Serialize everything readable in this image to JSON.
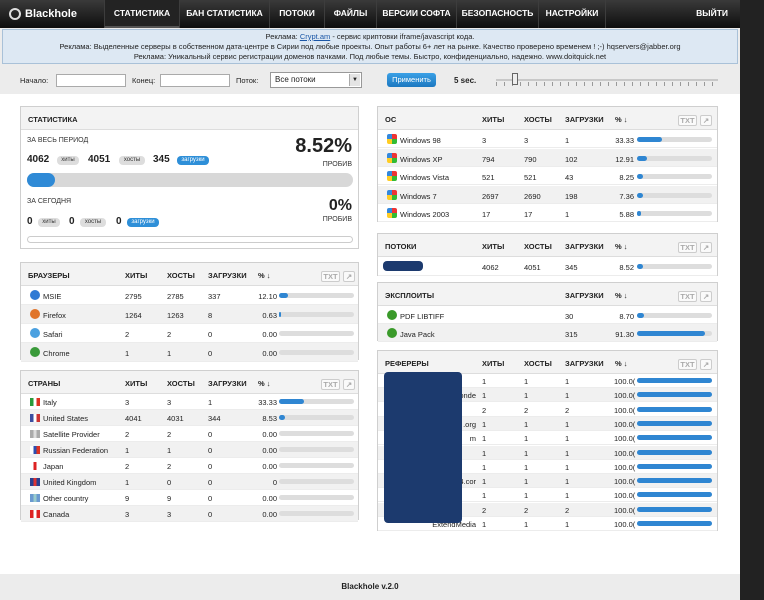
{
  "app": {
    "name": "Blackhole",
    "version": "Blackhole v.2.0"
  },
  "nav": {
    "items": [
      "СТАТИСТИКА",
      "БАН СТАТИСТИКА",
      "ПОТОКИ",
      "ФАЙЛЫ",
      "ВЕРСИИ СОФТА",
      "БЕЗОПАСНОСТЬ",
      "НАСТРОЙКИ"
    ],
    "exit": "ВЫЙТИ"
  },
  "ads": {
    "line1_pre": "Реклама: ",
    "line1_link": "Crypt.am",
    "line1_post": " - сервис криптовки iframe/javascript кода.",
    "line2": "Реклама: Выделенные серверы в собственном дата-центре в Сирии под любые проекты. Опыт работы 6+ лет на рынке. Качество проверено временем ! ;-) hqservers@jabber.org",
    "line3": "Реклама: Уникальный сервис регистрации доменов пачками. Под любые темы. Быстро, конфиденциально, надежно. www.doitquick.net"
  },
  "filter": {
    "start": "Начало:",
    "end": "Конец:",
    "thread": "Поток:",
    "thread_value": "Все потоки",
    "apply": "Применить",
    "interval": "5 sec."
  },
  "stats": {
    "title": "СТАТИСТИКА",
    "period_all": "ЗА ВЕСЬ ПЕРИОД",
    "hits": "4062",
    "hosts": "4051",
    "loads": "345",
    "pct": "8.52%",
    "pct_fill": 0.0852,
    "pct_label": "ПРОБИВ",
    "hits_label": "хиты",
    "hosts_label": "хосты",
    "loads_label": "загрузки",
    "today": "ЗА СЕГОДНЯ",
    "t_hits": "0",
    "t_hosts": "0",
    "t_loads": "0",
    "t_pct": "0%"
  },
  "cols": {
    "hits": "ХИТЫ",
    "hosts": "ХОСТЫ",
    "loads": "ЗАГРУЗКИ",
    "pct": "% ↓",
    "txt": "TXT",
    "ext": "↗"
  },
  "browsers": {
    "title": "БРАУЗЕРЫ",
    "rows": [
      {
        "name": "MSIE",
        "hits": "2795",
        "hosts": "2785",
        "loads": "337",
        "pct": "12.10",
        "fill": 0.121,
        "icon": "ie-icon",
        "color": "#2f7ad4"
      },
      {
        "name": "Firefox",
        "hits": "1264",
        "hosts": "1263",
        "loads": "8",
        "pct": "0.63",
        "fill": 0.0063,
        "icon": "firefox-icon",
        "color": "#e0742a"
      },
      {
        "name": "Safari",
        "hits": "2",
        "hosts": "2",
        "loads": "0",
        "pct": "0.00",
        "fill": 0,
        "icon": "safari-icon",
        "color": "#4aa0e0"
      },
      {
        "name": "Chrome",
        "hits": "1",
        "hosts": "1",
        "loads": "0",
        "pct": "0.00",
        "fill": 0,
        "icon": "chrome-icon",
        "color": "#3a9a3a"
      }
    ]
  },
  "countries": {
    "title": "СТРАНЫ",
    "rows": [
      {
        "name": "Italy",
        "hits": "3",
        "hosts": "3",
        "loads": "1",
        "pct": "33.33",
        "fill": 0.3333,
        "flag": [
          "#2a9a3a",
          "#fff",
          "#d32"
        ]
      },
      {
        "name": "United States",
        "hits": "4041",
        "hosts": "4031",
        "loads": "344",
        "pct": "8.53",
        "fill": 0.0853,
        "flag": [
          "#3b4ea0",
          "#fff",
          "#c33"
        ]
      },
      {
        "name": "Satellite Provider",
        "hits": "2",
        "hosts": "2",
        "loads": "0",
        "pct": "0.00",
        "fill": 0,
        "flag": [
          "#aaa",
          "#ddd",
          "#aaa"
        ]
      },
      {
        "name": "Russian Federation",
        "hits": "1",
        "hosts": "1",
        "loads": "0",
        "pct": "0.00",
        "fill": 0,
        "flag": [
          "#fff",
          "#2c4fb0",
          "#d32"
        ]
      },
      {
        "name": "Japan",
        "hits": "2",
        "hosts": "2",
        "loads": "0",
        "pct": "0.00",
        "fill": 0,
        "flag": [
          "#fff",
          "#d22",
          "#fff"
        ]
      },
      {
        "name": "United Kingdom",
        "hits": "1",
        "hosts": "0",
        "loads": "0",
        "pct": "0",
        "fill": 0,
        "flag": [
          "#2a3f8f",
          "#d33",
          "#2a3f8f"
        ]
      },
      {
        "name": "Other country",
        "hits": "9",
        "hosts": "9",
        "loads": "0",
        "pct": "0.00",
        "fill": 0,
        "flag": [
          "#6a9ad0",
          "#9cc",
          "#6a9ad0"
        ]
      },
      {
        "name": "Canada",
        "hits": "3",
        "hosts": "3",
        "loads": "0",
        "pct": "0.00",
        "fill": 0,
        "flag": [
          "#d22",
          "#fff",
          "#d22"
        ]
      }
    ]
  },
  "os": {
    "title": "ОС",
    "rows": [
      {
        "name": "Windows 98",
        "hits": "3",
        "hosts": "3",
        "loads": "1",
        "pct": "33.33",
        "fill": 0.3333
      },
      {
        "name": "Windows XP",
        "hits": "794",
        "hosts": "790",
        "loads": "102",
        "pct": "12.91",
        "fill": 0.1291
      },
      {
        "name": "Windows Vista",
        "hits": "521",
        "hosts": "521",
        "loads": "43",
        "pct": "8.25",
        "fill": 0.0825
      },
      {
        "name": "Windows 7",
        "hits": "2697",
        "hosts": "2690",
        "loads": "198",
        "pct": "7.36",
        "fill": 0.0736
      },
      {
        "name": "Windows 2003",
        "hits": "17",
        "hosts": "17",
        "loads": "1",
        "pct": "5.88",
        "fill": 0.0588
      }
    ]
  },
  "threads": {
    "title": "ПОТОКИ",
    "rows": [
      {
        "hits": "4062",
        "hosts": "4051",
        "loads": "345",
        "pct": "8.52",
        "fill": 0.0852
      }
    ]
  },
  "exploits": {
    "title": "ЭКСПЛОИТЫ",
    "rows": [
      {
        "name": "PDF LIBTIFF",
        "loads": "30",
        "pct": "8.70",
        "fill": 0.087
      },
      {
        "name": "Java Pack",
        "loads": "315",
        "pct": "91.30",
        "fill": 0.913
      }
    ]
  },
  "referers": {
    "title": "РЕФЕРЕРЫ",
    "rows": [
      {
        "frag": "",
        "hits": "1",
        "hosts": "1",
        "loads": "1",
        "pct": "100.0(",
        "fill": 1
      },
      {
        "frag": "onde",
        "hits": "1",
        "hosts": "1",
        "loads": "1",
        "pct": "100.0(",
        "fill": 1
      },
      {
        "frag": "",
        "hits": "2",
        "hosts": "2",
        "loads": "2",
        "pct": "100.0(",
        "fill": 1
      },
      {
        "frag": ".org",
        "hits": "1",
        "hosts": "1",
        "loads": "1",
        "pct": "100.0(",
        "fill": 1
      },
      {
        "frag": "m",
        "hits": "1",
        "hosts": "1",
        "loads": "1",
        "pct": "100.0(",
        "fill": 1
      },
      {
        "frag": "",
        "hits": "1",
        "hosts": "1",
        "loads": "1",
        "pct": "100.0(",
        "fill": 1
      },
      {
        "frag": "",
        "hits": "1",
        "hosts": "1",
        "loads": "1",
        "pct": "100.0(",
        "fill": 1
      },
      {
        "frag": "4.cor",
        "hits": "1",
        "hosts": "1",
        "loads": "1",
        "pct": "100.0(",
        "fill": 1
      },
      {
        "frag": "",
        "hits": "1",
        "hosts": "1",
        "loads": "1",
        "pct": "100.0(",
        "fill": 1
      },
      {
        "frag": "",
        "hits": "2",
        "hosts": "2",
        "loads": "2",
        "pct": "100.0(",
        "fill": 1
      },
      {
        "frag": "ExtendMedia",
        "hits": "1",
        "hosts": "1",
        "loads": "1",
        "pct": "100.0(",
        "fill": 1
      }
    ]
  }
}
